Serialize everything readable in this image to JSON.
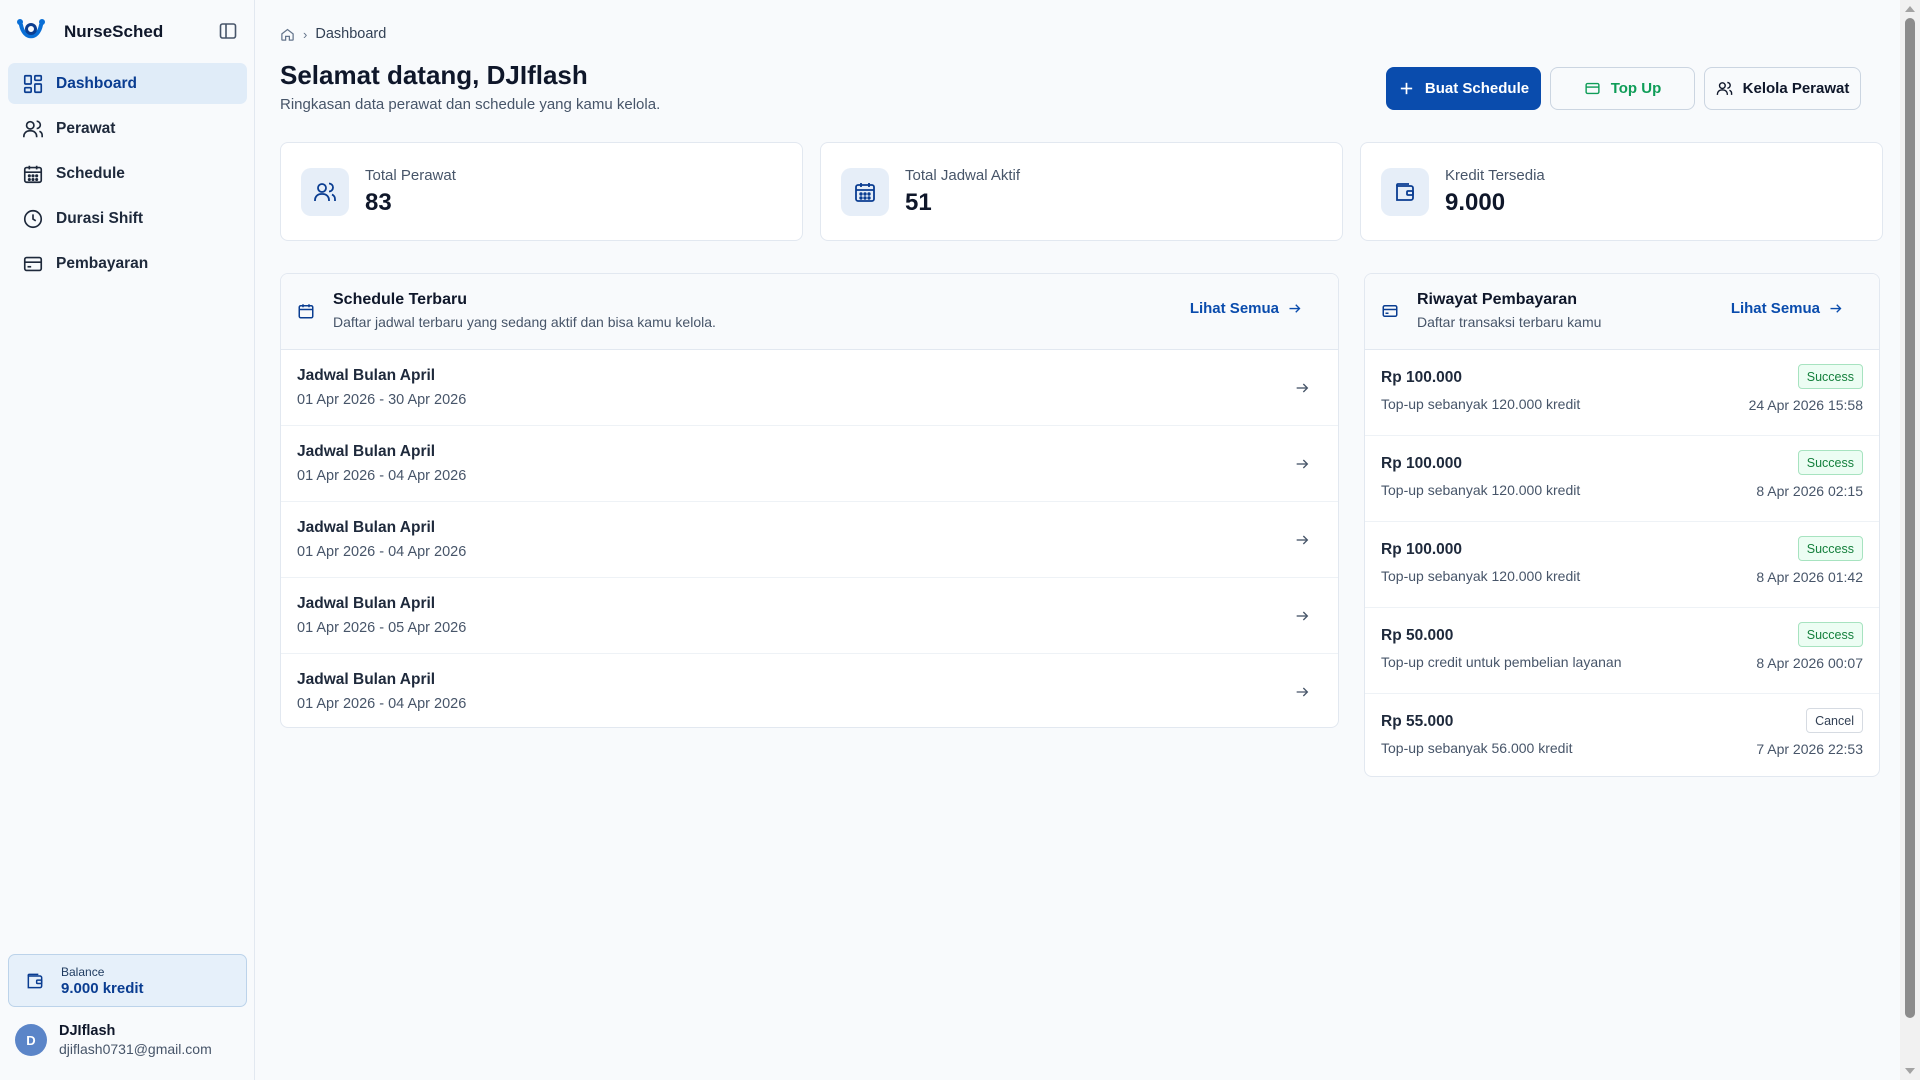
{
  "sidebar": {
    "brand": "NurseSched",
    "items": [
      {
        "label": "Dashboard",
        "icon": "dashboard-icon",
        "active": true
      },
      {
        "label": "Perawat",
        "icon": "users-icon",
        "active": false
      },
      {
        "label": "Schedule",
        "icon": "calendar-icon",
        "active": false
      },
      {
        "label": "Durasi Shift",
        "icon": "clock-icon",
        "active": false
      },
      {
        "label": "Pembayaran",
        "icon": "credit-card-icon",
        "active": false
      }
    ],
    "balance": {
      "label": "Balance",
      "value": "9.000 kredit"
    },
    "user": {
      "initial": "D",
      "name": "DJIflash",
      "email": "djiflash0731@gmail.com"
    }
  },
  "breadcrumb": {
    "current": "Dashboard"
  },
  "header": {
    "title": "Selamat datang, DJIflash",
    "subtitle": "Ringkasan data perawat dan schedule yang kamu kelola.",
    "buttons": {
      "create": "Buat Schedule",
      "topup": "Top Up",
      "manage": "Kelola Perawat"
    }
  },
  "stats": [
    {
      "label": "Total Perawat",
      "value": "83",
      "icon": "users-icon"
    },
    {
      "label": "Total Jadwal Aktif",
      "value": "51",
      "icon": "calendar-icon"
    },
    {
      "label": "Kredit Tersedia",
      "value": "9.000",
      "icon": "wallet-icon"
    }
  ],
  "schedule_panel": {
    "title": "Schedule Terbaru",
    "subtitle": "Daftar jadwal terbaru yang sedang aktif dan bisa kamu kelola.",
    "link": "Lihat Semua",
    "rows": [
      {
        "name": "Jadwal Bulan April",
        "range": "01 Apr 2026 - 30 Apr 2026"
      },
      {
        "name": "Jadwal Bulan April",
        "range": "01 Apr 2026 - 04 Apr 2026"
      },
      {
        "name": "Jadwal Bulan April",
        "range": "01 Apr 2026 - 04 Apr 2026"
      },
      {
        "name": "Jadwal Bulan April",
        "range": "01 Apr 2026 - 05 Apr 2026"
      },
      {
        "name": "Jadwal Bulan April",
        "range": "01 Apr 2026 - 04 Apr 2026"
      }
    ]
  },
  "payment_panel": {
    "title": "Riwayat Pembayaran",
    "subtitle": "Daftar transaksi terbaru kamu",
    "link": "Lihat Semua",
    "rows": [
      {
        "amount": "Rp 100.000",
        "desc": "Top-up sebanyak 120.000 kredit",
        "status": "Success",
        "date": "24 Apr 2026 15:58"
      },
      {
        "amount": "Rp 100.000",
        "desc": "Top-up sebanyak 120.000 kredit",
        "status": "Success",
        "date": "8 Apr 2026 02:15"
      },
      {
        "amount": "Rp 100.000",
        "desc": "Top-up sebanyak 120.000 kredit",
        "status": "Success",
        "date": "8 Apr 2026 01:42"
      },
      {
        "amount": "Rp 50.000",
        "desc": "Top-up credit untuk pembelian layanan",
        "status": "Success",
        "date": "8 Apr 2026 00:07"
      },
      {
        "amount": "Rp 55.000",
        "desc": "Top-up sebanyak 56.000 kredit",
        "status": "Cancel",
        "date": "7 Apr 2026 22:53"
      }
    ]
  },
  "colors": {
    "primary": "#0a4cad",
    "active_nav_bg": "#e0ecf8",
    "success": "#15803d",
    "topup": "#0f9d58"
  }
}
